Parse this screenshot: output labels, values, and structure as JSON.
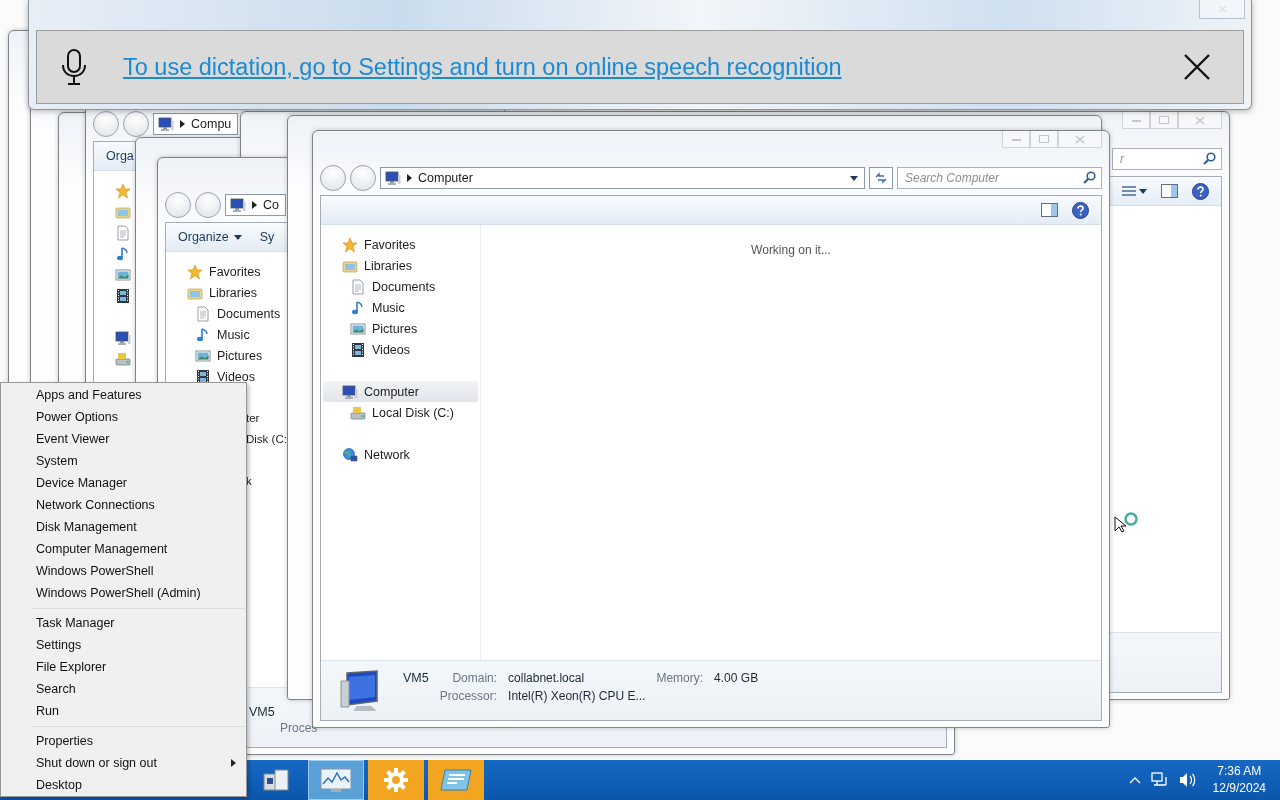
{
  "dictation_banner": {
    "message": "To use dictation, go to Settings and turn on online speech recognition"
  },
  "back_window_left": {
    "location": "Compu",
    "toolbar": [
      {
        "label": "Orga"
      }
    ]
  },
  "back_window_right": {
    "search_placeholder": "r"
  },
  "middle_window": {
    "location": "Co",
    "toolbar": [
      {
        "label": "Organize",
        "menu": true
      },
      {
        "label": "Sy"
      }
    ],
    "nav": [
      {
        "label": "Favorites",
        "kind": "star",
        "selected": false
      },
      {
        "label": "Libraries",
        "kind": "library",
        "selected": false,
        "children": [
          {
            "label": "Documents",
            "kind": "document",
            "selected": false
          },
          {
            "label": "Music",
            "kind": "music",
            "selected": false
          },
          {
            "label": "Pictures",
            "kind": "pictures",
            "selected": false
          },
          {
            "label": "Videos",
            "kind": "videos",
            "selected": false
          }
        ]
      }
    ],
    "nav_peek": [
      [
        {
          "label": "ter"
        },
        {
          "label": "Disk (C:"
        }
      ],
      [
        {
          "label": "k"
        }
      ]
    ],
    "details_peek": {
      "name": "VM5",
      "label": "Proces"
    }
  },
  "front_window": {
    "location": "Computer",
    "search_placeholder": "Search Computer",
    "nav": [
      {
        "label": "Favorites",
        "kind": "star",
        "selected": false
      },
      {
        "label": "Libraries",
        "kind": "library",
        "selected": false,
        "children": [
          {
            "label": "Documents",
            "kind": "document",
            "selected": false
          },
          {
            "label": "Music",
            "kind": "music",
            "selected": false
          },
          {
            "label": "Pictures",
            "kind": "pictures",
            "selected": false
          },
          {
            "label": "Videos",
            "kind": "videos",
            "selected": false
          }
        ]
      },
      {
        "label": "Computer",
        "kind": "computer",
        "selected": true,
        "children": [
          {
            "label": "Local Disk (C:)",
            "kind": "disk",
            "selected": false
          }
        ]
      },
      {
        "label": "Network",
        "kind": "network",
        "selected": false
      }
    ],
    "status": "Working on it...",
    "details": {
      "name": "VM5",
      "rows": [
        [
          {
            "label": "Domain:",
            "value": "collabnet.local"
          },
          {
            "label": "Memory:",
            "value": "4.00 GB"
          }
        ],
        [
          {
            "label": "Processor:",
            "value": "Intel(R) Xeon(R) CPU E..."
          }
        ]
      ]
    }
  },
  "context_menu": {
    "groups": [
      [
        {
          "label": "Apps and Features",
          "submenu": false
        },
        {
          "label": "Power Options",
          "submenu": false
        },
        {
          "label": "Event Viewer",
          "submenu": false
        },
        {
          "label": "System",
          "submenu": false
        },
        {
          "label": "Device Manager",
          "submenu": false
        },
        {
          "label": "Network Connections",
          "submenu": false
        },
        {
          "label": "Disk Management",
          "submenu": false
        },
        {
          "label": "Computer Management",
          "submenu": false
        },
        {
          "label": "Windows PowerShell",
          "submenu": false
        },
        {
          "label": "Windows PowerShell (Admin)",
          "submenu": false
        }
      ],
      [
        {
          "label": "Task Manager",
          "submenu": false
        },
        {
          "label": "Settings",
          "submenu": false
        },
        {
          "label": "File Explorer",
          "submenu": false
        },
        {
          "label": "Search",
          "submenu": false
        },
        {
          "label": "Run",
          "submenu": false
        }
      ],
      [
        {
          "label": "Properties",
          "submenu": false
        },
        {
          "label": "Shut down or sign out",
          "submenu": true
        },
        {
          "label": "Desktop",
          "submenu": false
        }
      ]
    ]
  },
  "taskbar": {
    "apps": [
      {
        "hovered": false,
        "active": false
      },
      {
        "hovered": true,
        "active": false
      },
      {
        "hovered": false,
        "active": true
      },
      {
        "hovered": false,
        "active": true
      }
    ],
    "tray": {
      "time": "7:36 AM",
      "date": "12/9/2024"
    }
  }
}
